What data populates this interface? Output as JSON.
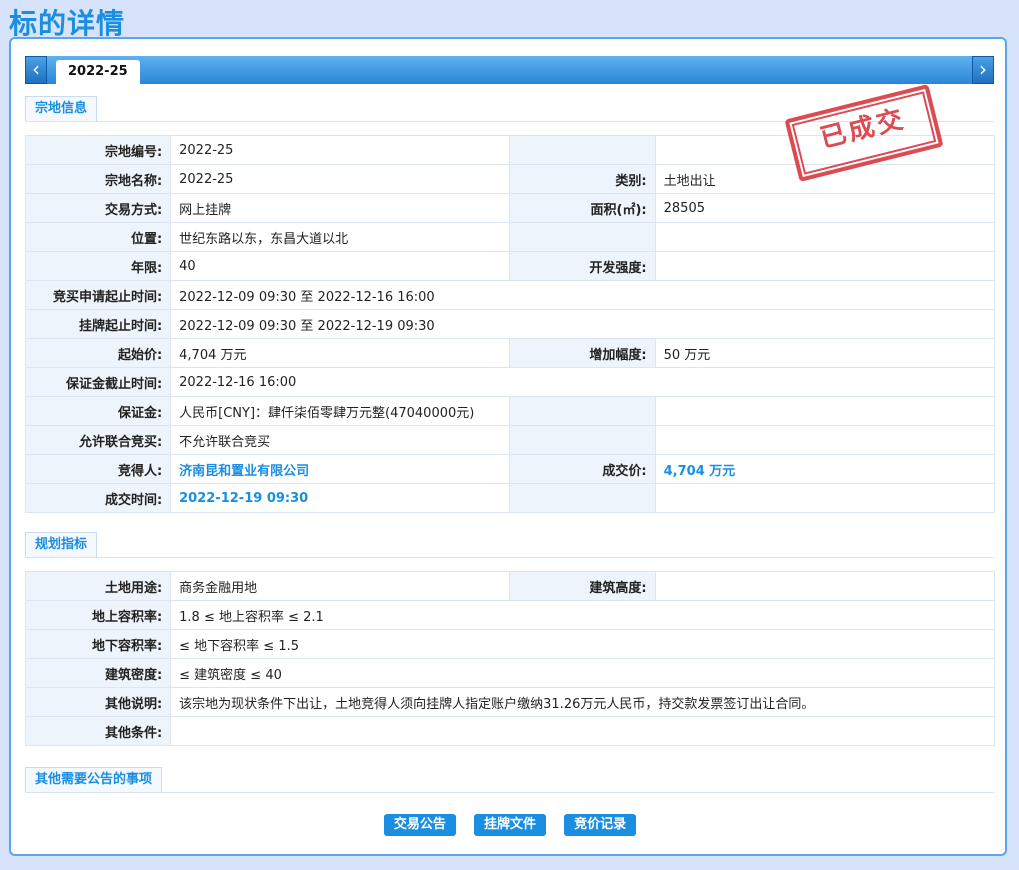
{
  "page": {
    "title": "标的详情"
  },
  "tabs": {
    "prev_icon": "chevron-left-icon",
    "next_icon": "chevron-right-icon",
    "active": "2022-25"
  },
  "stamp": {
    "text": "已成交",
    "color": "#d8333b"
  },
  "section1": {
    "label": "宗地信息",
    "rows": [
      [
        {
          "k": "宗地编号:",
          "v": "2022-25"
        },
        {
          "k": "",
          "v": ""
        }
      ],
      [
        {
          "k": "宗地名称:",
          "v": "2022-25"
        },
        {
          "k": "类别:",
          "v": "土地出让"
        }
      ],
      [
        {
          "k": "交易方式:",
          "v": "网上挂牌"
        },
        {
          "k": "面积(㎡):",
          "v": "28505"
        }
      ],
      [
        {
          "k": "位置:",
          "v": "世纪东路以东，东昌大道以北"
        },
        {
          "k": "",
          "v": ""
        }
      ],
      [
        {
          "k": "年限:",
          "v": "40"
        },
        {
          "k": "开发强度:",
          "v": ""
        }
      ],
      [
        {
          "k": "竞买申请起止时间:",
          "v": "2022-12-09 09:30 至 2022-12-16 16:00",
          "full": true
        }
      ],
      [
        {
          "k": "挂牌起止时间:",
          "v": "2022-12-09 09:30 至 2022-12-19 09:30",
          "full": true
        }
      ],
      [
        {
          "k": "起始价:",
          "v": "4,704 万元"
        },
        {
          "k": "增加幅度:",
          "v": "50 万元"
        }
      ],
      [
        {
          "k": "保证金截止时间:",
          "v": "2022-12-16 16:00",
          "full": true
        }
      ],
      [
        {
          "k": "保证金:",
          "v": "人民币[CNY]：肆仟柒佰零肆万元整(47040000元)"
        },
        {
          "k": "",
          "v": ""
        }
      ],
      [
        {
          "k": "允许联合竞买:",
          "v": "不允许联合竞买"
        },
        {
          "k": "",
          "v": ""
        }
      ],
      [
        {
          "k": "竞得人:",
          "v": "济南昆和置业有限公司",
          "blue": true
        },
        {
          "k": "成交价:",
          "v": "4,704 万元",
          "blue": true
        }
      ],
      [
        {
          "k": "成交时间:",
          "v": "2022-12-19 09:30",
          "blue": true
        },
        {
          "k": "",
          "v": ""
        }
      ]
    ]
  },
  "section2": {
    "label": "规划指标",
    "rows": [
      [
        {
          "k": "土地用途:",
          "v": "商务金融用地"
        },
        {
          "k": "建筑高度:",
          "v": ""
        }
      ],
      [
        {
          "k": "地上容积率:",
          "v": "1.8 ≤ 地上容积率 ≤ 2.1",
          "full": true
        }
      ],
      [
        {
          "k": "地下容积率:",
          "v": "≤ 地下容积率 ≤ 1.5",
          "full": true
        }
      ],
      [
        {
          "k": "建筑密度:",
          "v": "≤ 建筑密度 ≤ 40",
          "full": true
        }
      ],
      [
        {
          "k": "其他说明:",
          "v": "该宗地为现状条件下出让，土地竞得人须向挂牌人指定账户缴纳31.26万元人民币，持交款发票签订出让合同。",
          "full": true
        }
      ],
      [
        {
          "k": "其他条件:",
          "v": "",
          "full": true
        }
      ]
    ]
  },
  "section3": {
    "label": "其他需要公告的事项"
  },
  "buttons": [
    "交易公告",
    "挂牌文件",
    "竞价记录"
  ]
}
